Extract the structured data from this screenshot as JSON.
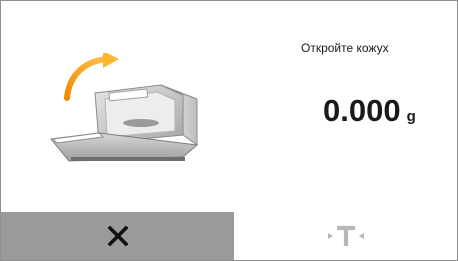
{
  "message": {
    "text": "Откройте кожух"
  },
  "reading": {
    "value": "0.000",
    "unit": "g"
  },
  "illustration": {
    "icon": "balance-open-draft-shield-icon",
    "arrow_color": "#f5a623"
  },
  "buttons": {
    "cancel": {
      "icon": "close-icon",
      "background": "#9a9a9a"
    },
    "tare": {
      "icon": "tare-icon",
      "state": "disabled",
      "color": "#b8b8b8"
    }
  }
}
